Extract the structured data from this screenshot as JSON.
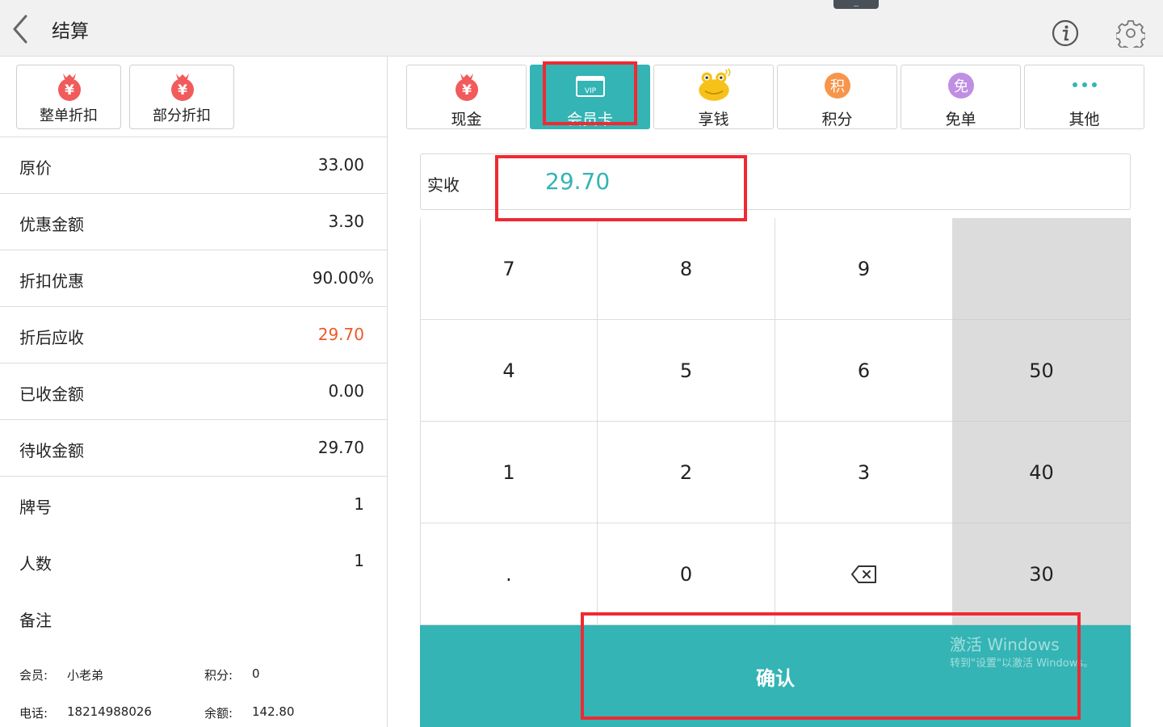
{
  "header": {
    "title": "结算",
    "back_icon": "chevron-left-icon",
    "info_icon": "info-icon",
    "settings_icon": "gear-icon"
  },
  "discounts": [
    {
      "label": "整单折扣",
      "icon": "money-bag-icon"
    },
    {
      "label": "部分折扣",
      "icon": "money-bag-icon"
    }
  ],
  "summary": {
    "original_price": {
      "label": "原价",
      "value": "33.00"
    },
    "discount_amount": {
      "label": "优惠金额",
      "value": "3.30"
    },
    "discount_rate": {
      "label": "折扣优惠",
      "value": "90.00%"
    },
    "payable": {
      "label": "折后应收",
      "value": "29.70"
    },
    "received": {
      "label": "已收金额",
      "value": "0.00"
    },
    "pending": {
      "label": "待收金额",
      "value": "29.70"
    },
    "table_no": {
      "label": "牌号",
      "value": "1"
    },
    "guests": {
      "label": "人数",
      "value": "1"
    },
    "remark": {
      "label": "备注",
      "value": ""
    }
  },
  "member": {
    "name_label": "会员:",
    "name": "小老弟",
    "points_label": "积分:",
    "points": "0",
    "phone_label": "电话:",
    "phone": "18214988026",
    "balance_label": "余额:",
    "balance": "142.80"
  },
  "payment_methods": [
    {
      "label": "现金",
      "icon": "money-bag-icon",
      "active": false
    },
    {
      "label": "会员卡",
      "icon": "vip-card-icon",
      "badge": "VIP",
      "active": true
    },
    {
      "label": "享钱",
      "icon": "frog-mascot-icon",
      "active": false
    },
    {
      "label": "积分",
      "icon": "points-icon",
      "badge": "积",
      "active": false
    },
    {
      "label": "免单",
      "icon": "free-icon",
      "badge": "免",
      "active": false
    },
    {
      "label": "其他",
      "icon": "more-icon",
      "active": false
    }
  ],
  "amount": {
    "label": "实收",
    "value": "29.70"
  },
  "keypad": {
    "k7": "7",
    "k8": "8",
    "k9": "9",
    "q_blank": "",
    "k4": "4",
    "k5": "5",
    "k6": "6",
    "q50": "50",
    "k1": "1",
    "k2": "2",
    "k3": "3",
    "q40": "40",
    "kdot": ".",
    "k0": "0",
    "backspace_icon": "backspace-icon",
    "q30": "30"
  },
  "confirm_label": "确认",
  "watermark": {
    "line1": "激活 Windows",
    "line2": "转到\"设置\"以激活 Windows。"
  },
  "colors": {
    "accent": "#34b4b4",
    "highlight": "#ee5a2a",
    "annotation": "#ee2a32"
  }
}
